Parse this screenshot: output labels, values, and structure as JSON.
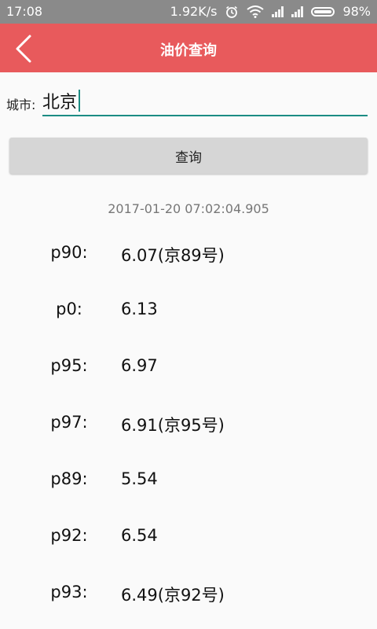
{
  "status_bar": {
    "time": "17:08",
    "network_speed": "1.92K/s",
    "battery_percent": "98%",
    "battery_level": 0.98,
    "icons": [
      "alarm-icon",
      "wifi-icon",
      "signal-icon",
      "signal-icon",
      "battery-icon"
    ]
  },
  "app_bar": {
    "title": "油价查询",
    "back_icon": "chevron-left-icon",
    "color": "#e85a5c"
  },
  "form": {
    "city_label": "城市:",
    "city_value": "北京",
    "query_label": "查询",
    "accent_color": "#1b8c84"
  },
  "result": {
    "timestamp": "2017-01-20 07:02:04.905",
    "prices": [
      {
        "key": "p90:",
        "value": "6.07(京89号)"
      },
      {
        "key": "p0:",
        "value": "6.13"
      },
      {
        "key": "p95:",
        "value": "6.97"
      },
      {
        "key": "p97:",
        "value": "6.91(京95号)"
      },
      {
        "key": "p89:",
        "value": "5.54"
      },
      {
        "key": "p92:",
        "value": "6.54"
      },
      {
        "key": "p93:",
        "value": "6.49(京92号)"
      }
    ]
  }
}
